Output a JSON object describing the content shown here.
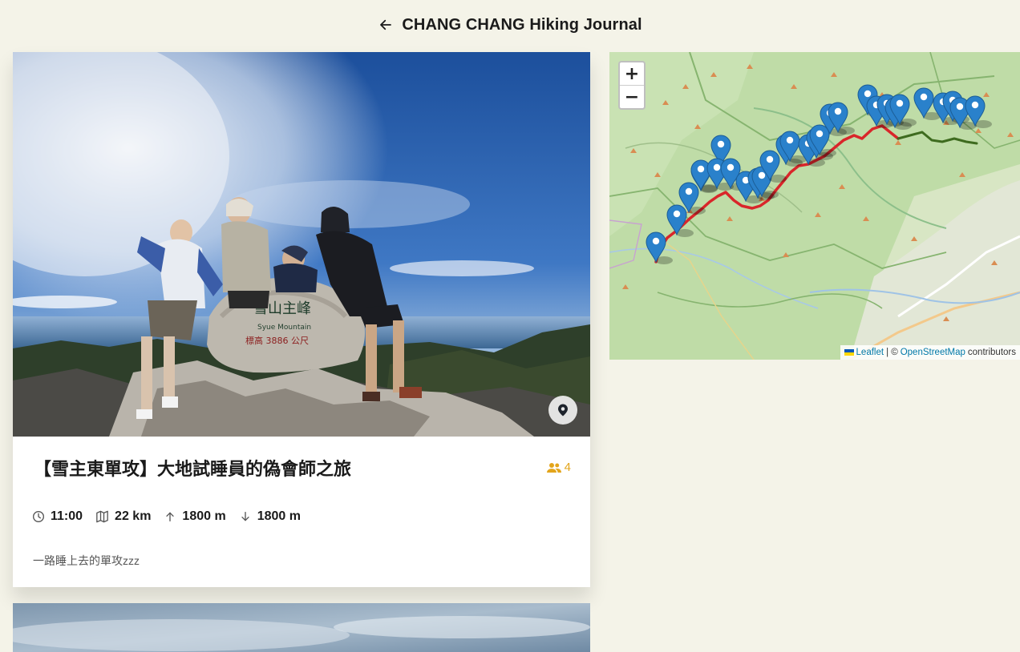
{
  "header": {
    "title": "CHANG CHANG Hiking Journal",
    "back_icon": "arrow-left-icon"
  },
  "journal": {
    "title": "【雪主東單攻】大地試睡員的偽會師之旅",
    "members": "4",
    "stats": {
      "duration": "11:00",
      "distance": "22 km",
      "ascent": "1800 m",
      "descent": "1800 m"
    },
    "description": "一路睡上去的單攻zzz",
    "photo_sign": "雪山主峰",
    "icons": [
      "location-pin-icon",
      "users-icon",
      "clock-icon",
      "map-icon",
      "arrow-up-icon",
      "arrow-down-icon"
    ]
  },
  "map": {
    "zoom_in": "+",
    "zoom_out": "−",
    "attribution": {
      "leaflet": "Leaflet",
      "separator": "| ©",
      "osm": "OpenStreetMap",
      "suffix": "contributors"
    },
    "colors": {
      "route": "#d9262a",
      "route_east": "#3e6b1f",
      "marker": "#2a81cb",
      "land": "#bfdca7"
    }
  }
}
